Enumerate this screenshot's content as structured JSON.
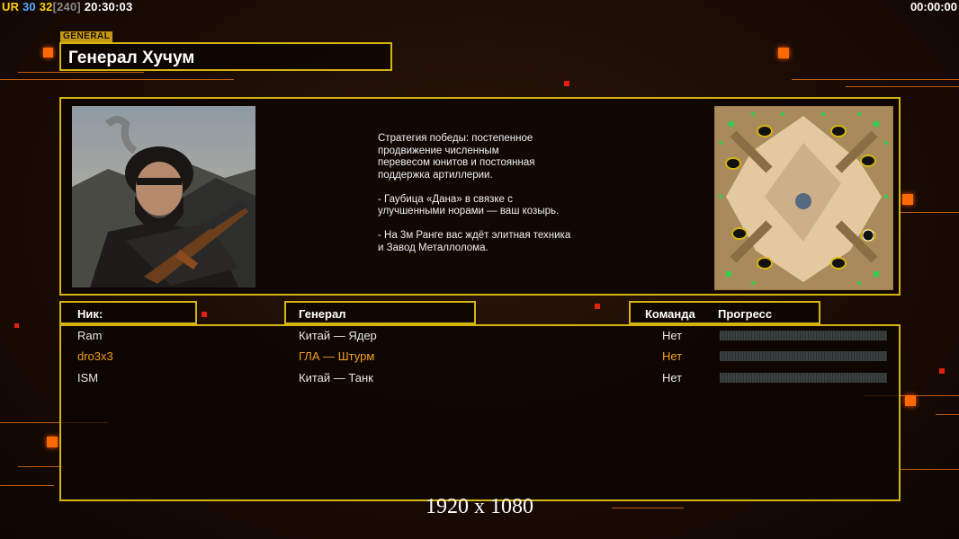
{
  "hud": {
    "ur": "UR",
    "fps1": "30",
    "fps2": "32",
    "fps_bracket": "[240]",
    "clock": "20:30:03",
    "timer": "00:00:00"
  },
  "header": {
    "tag": "GENERAL",
    "title": "Генерал Хучум"
  },
  "general": {
    "portrait": "general-portrait",
    "description": "Стратегия победы: постепенное\nпродвижение численным\nперевесом юнитов и постоянная\nподдержка артиллерии.\n\n- Гаубица «Дана» в связке с\nулучшенными норами — ваш козырь.\n\n- На 3м Ранге вас ждёт элитная техника\nи Завод Металлолома.",
    "minimap": "map-preview"
  },
  "columns": {
    "nick": "Ник:",
    "general": "Генерал",
    "team": "Команда",
    "progress": "Прогресс"
  },
  "players": [
    {
      "nick": "Ram",
      "general": "Китай — Ядер",
      "team": "Нет"
    },
    {
      "nick": "dro3x3",
      "general": "ГЛА — Штурм",
      "team": "Нет"
    },
    {
      "nick": "ISM",
      "general": "Китай — Танк",
      "team": "Нет"
    }
  ],
  "resolution": "1920 x 1080",
  "colors": {
    "accent": "#d6b410",
    "highlight": "#f0a020",
    "background": "#1a0d05"
  }
}
